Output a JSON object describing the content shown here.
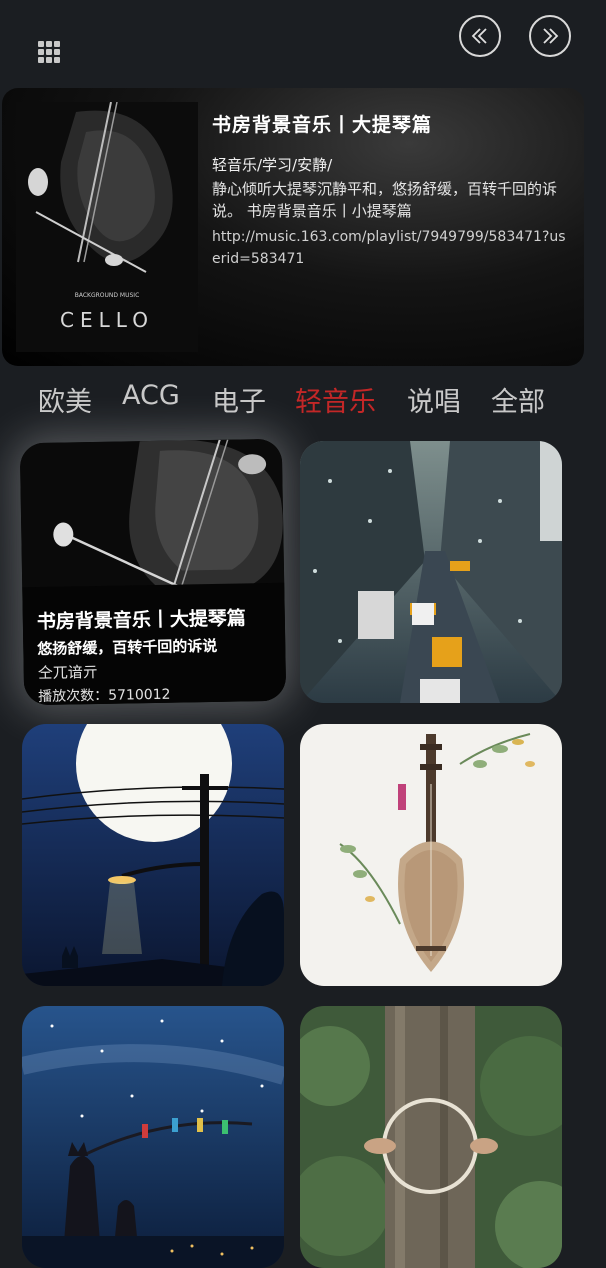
{
  "header": {
    "menu_icon": "grid-icon",
    "prev_icon": "double-chevron-left-icon",
    "next_icon": "double-chevron-right-icon"
  },
  "featured": {
    "title": "书房背景音乐丨大提琴篇",
    "tags": "轻音乐/学习/安静/",
    "description": "静心倾听大提琴沉静平和，悠扬舒缓，百转千回的诉说。 书房背景音乐丨小提琴篇",
    "url": "http://music.163.com/playlist/7949799/583471?userid=583471",
    "cover_text": "CELLO",
    "cover_caption": "BACKGROUND MUSIC"
  },
  "tabs": [
    {
      "label": "欧美",
      "active": false
    },
    {
      "label": "ACG",
      "active": false
    },
    {
      "label": "电子",
      "active": false
    },
    {
      "label": "轻音乐",
      "active": true
    },
    {
      "label": "说唱",
      "active": false
    },
    {
      "label": "全部",
      "active": false
    }
  ],
  "cards": [
    {
      "title": "书房背景音乐丨大提琴篇",
      "desc": "悠扬舒缓，百转千回的诉说",
      "author": "仝兀谙亓",
      "plays": "播放次数：5710012",
      "image": "cello"
    },
    {
      "image": "rainy-street"
    },
    {
      "image": "moon-streetlight"
    },
    {
      "image": "pipa-flowers"
    },
    {
      "image": "starry-night"
    },
    {
      "image": "forest-tree"
    }
  ],
  "colors": {
    "background": "#1b1e22",
    "active_tab": "#c32727",
    "inactive_tab": "#c8c8c8"
  }
}
